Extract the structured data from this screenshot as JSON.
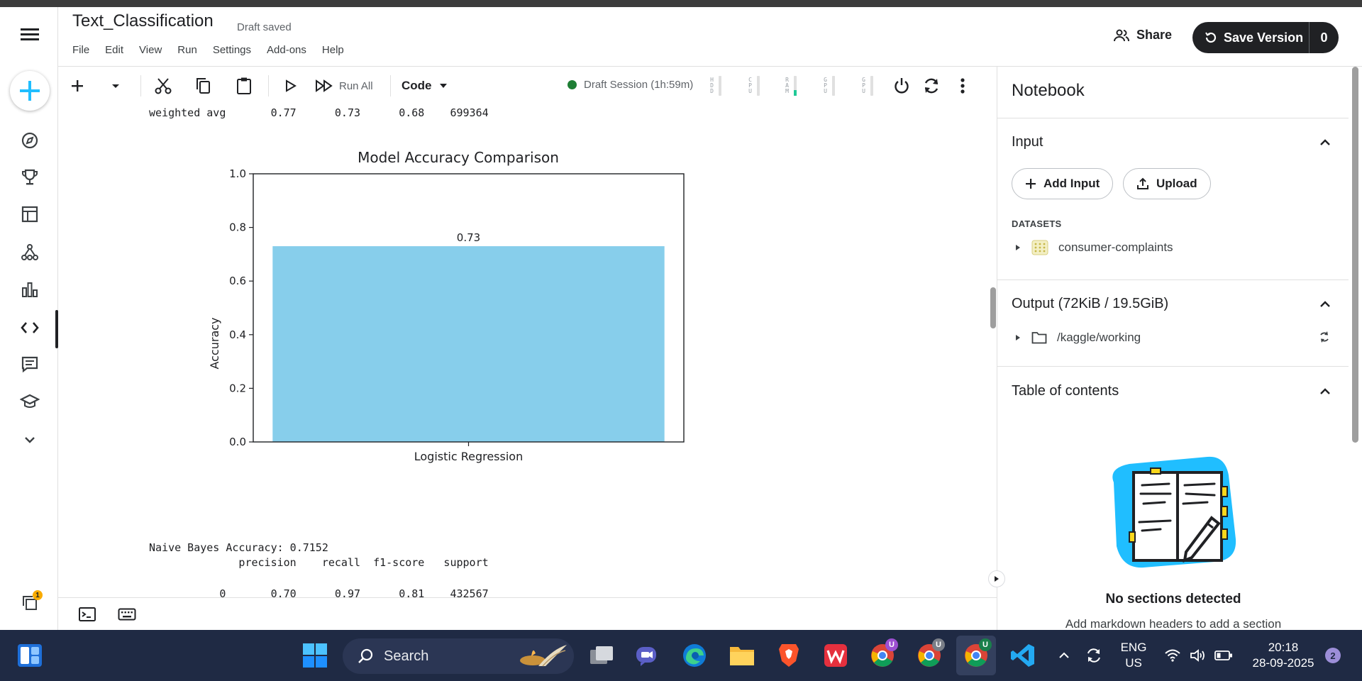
{
  "notebook": {
    "title": "Text_Classification",
    "status": "Draft saved"
  },
  "menu": [
    "File",
    "Edit",
    "View",
    "Run",
    "Settings",
    "Add-ons",
    "Help"
  ],
  "header": {
    "share_label": "Share",
    "save_label": "Save Version",
    "save_count": "0"
  },
  "toolbar": {
    "run_all_label": "Run All",
    "cell_type": "Code",
    "session": "Draft Session (1h:59m)",
    "meters": [
      {
        "label": "HDD",
        "level": 0
      },
      {
        "label": "CPU",
        "level": 0
      },
      {
        "label": "RAM",
        "level": 0.3
      },
      {
        "label": "GPU",
        "level": 0
      },
      {
        "label": "GPU",
        "level": 0
      }
    ]
  },
  "output": {
    "line_weighted": "weighted avg       0.77      0.73      0.68    699364",
    "line_nb": "Naive Bayes Accuracy: 0.7152",
    "line_header": "              precision    recall  f1-score   support",
    "line_row0": "           0       0.70      0.97      0.81    432567"
  },
  "chart_data": {
    "type": "bar",
    "title": "Model Accuracy Comparison",
    "xlabel": "",
    "ylabel": "Accuracy",
    "categories": [
      "Logistic Regression"
    ],
    "values": [
      0.73
    ],
    "data_labels": [
      "0.73"
    ],
    "ylim": [
      0,
      1.0
    ],
    "yticks": [
      "0.0",
      "0.2",
      "0.4",
      "0.6",
      "0.8",
      "1.0"
    ],
    "bar_color": "#87ceeb",
    "grid": false
  },
  "panel": {
    "title": "Notebook",
    "input_title": "Input",
    "add_input_label": "Add Input",
    "upload_label": "Upload",
    "datasets_label": "DATASETS",
    "dataset_name": "consumer-complaints",
    "output_title": "Output (72KiB / 19.5GiB)",
    "output_path": "/kaggle/working",
    "toc_title": "Table of contents",
    "empty_title": "No sections detected",
    "empty_sub": "Add markdown headers to add a section"
  },
  "taskbar": {
    "search_label": "Search",
    "lang_line1": "ENG",
    "lang_line2": "US",
    "time": "20:18",
    "date": "28-09-2025",
    "notif_count": "2",
    "rail_badge": "1",
    "chrome_badge_a": "U",
    "chrome_badge_b": "U",
    "chrome_badge_c": "U"
  },
  "colors": {
    "accent": "#20beff",
    "session_dot": "#1e7e34",
    "taskbar": "#1f2a44"
  }
}
